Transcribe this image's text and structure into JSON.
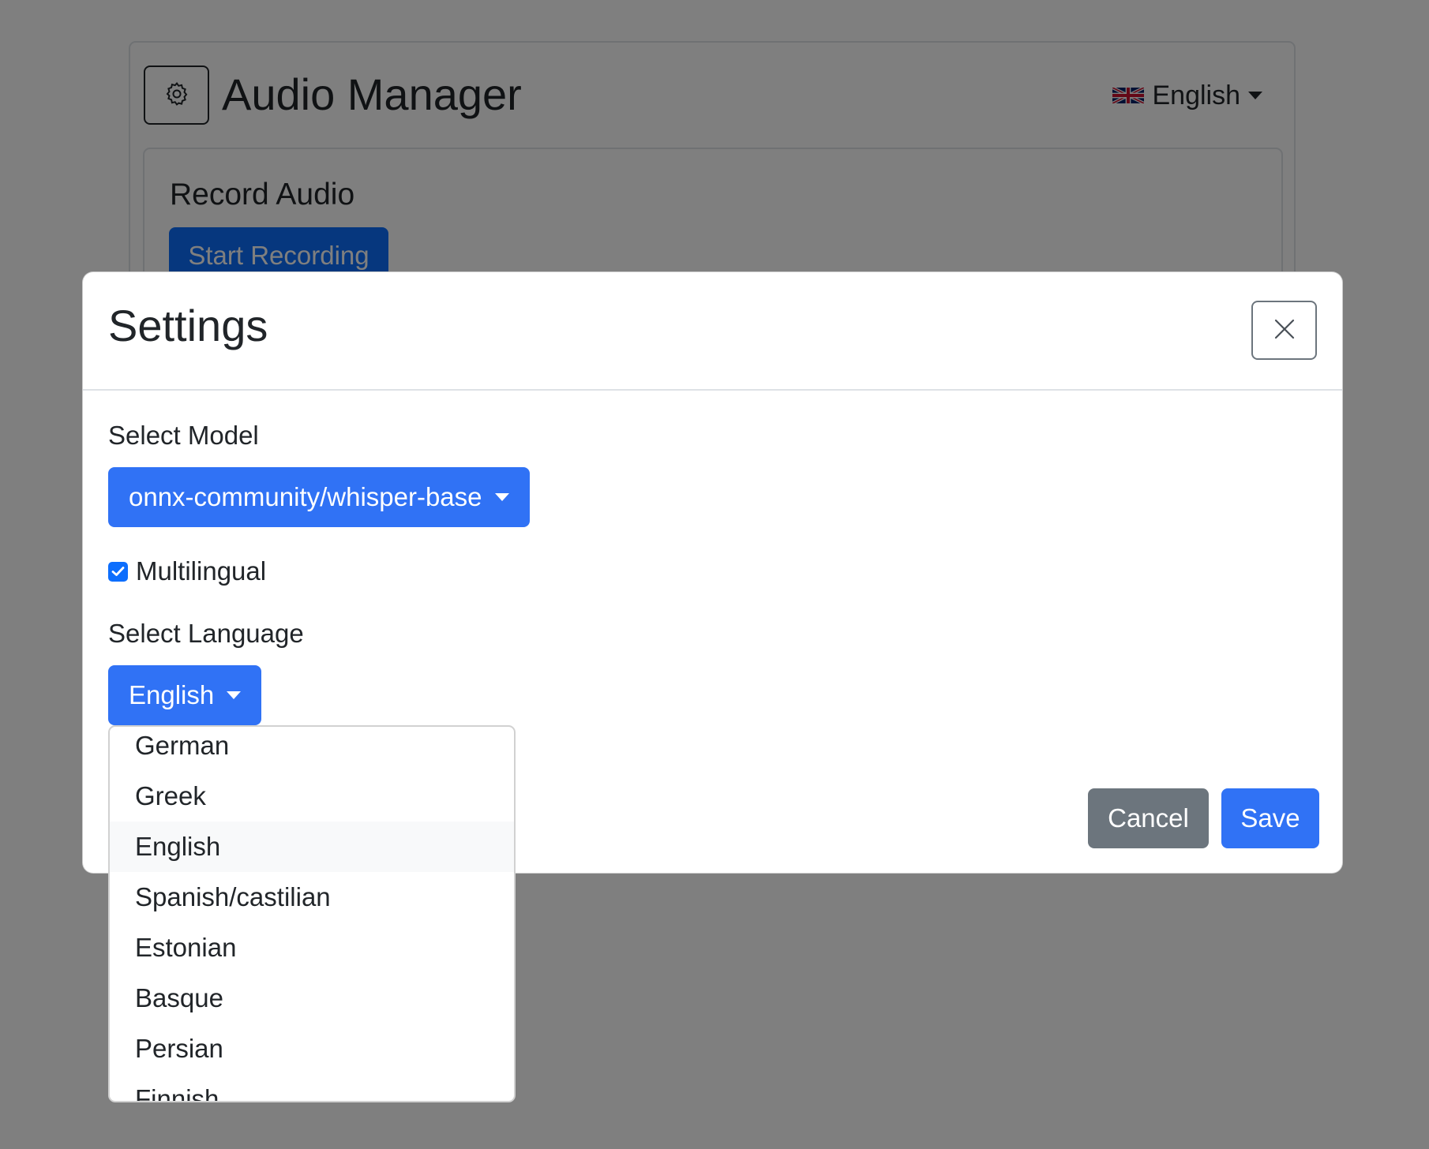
{
  "app": {
    "title": "Audio Manager",
    "language_switch": {
      "flag": "uk-flag-icon",
      "label": "English"
    },
    "record_section": {
      "title": "Record Audio",
      "start_label": "Start Recording"
    }
  },
  "modal": {
    "title": "Settings",
    "close_icon": "close-icon",
    "model": {
      "label": "Select Model",
      "selected": "onnx-community/whisper-base"
    },
    "multilingual": {
      "label": "Multilingual",
      "checked": true
    },
    "language": {
      "label": "Select Language",
      "selected": "English",
      "options": [
        "German",
        "Greek",
        "English",
        "Spanish/castilian",
        "Estonian",
        "Basque",
        "Persian",
        "Finnish"
      ]
    },
    "cancel_label": "Cancel",
    "save_label": "Save"
  },
  "colors": {
    "primary": "#0d6efd",
    "primary_button": "#3072f5",
    "secondary": "#6c757d",
    "backdrop": "rgba(0,0,0,0.5)"
  }
}
